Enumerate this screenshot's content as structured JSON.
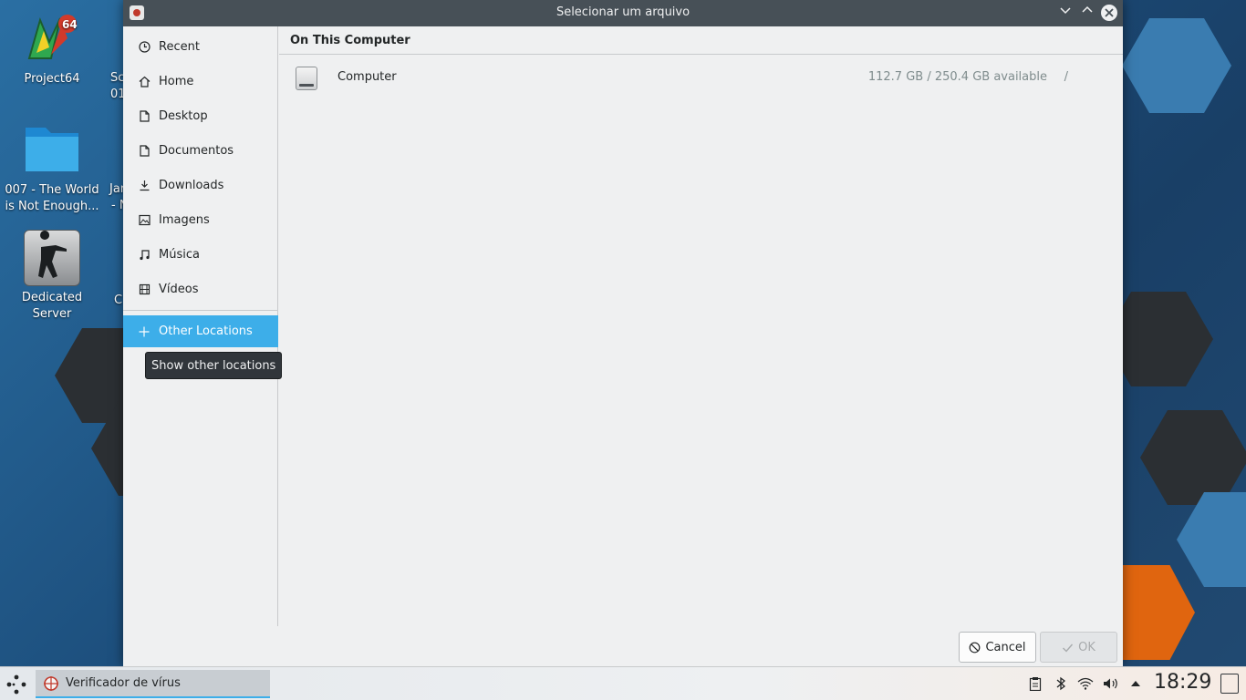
{
  "desktop": {
    "icons": [
      {
        "label": "Project64"
      },
      {
        "label": "007 - The World is Not Enough..."
      },
      {
        "label": "Dedicated Server"
      }
    ],
    "partial_labels": [
      "Sc",
      "01",
      "Jar",
      "- N",
      "C"
    ]
  },
  "dialog": {
    "title": "Selecionar um arquivo",
    "sidebar": {
      "items": [
        {
          "label": "Recent",
          "icon": "clock-icon"
        },
        {
          "label": "Home",
          "icon": "home-icon"
        },
        {
          "label": "Desktop",
          "icon": "desktop-icon"
        },
        {
          "label": "Documentos",
          "icon": "documents-icon"
        },
        {
          "label": "Downloads",
          "icon": "downloads-icon"
        },
        {
          "label": "Imagens",
          "icon": "pictures-icon"
        },
        {
          "label": "Música",
          "icon": "music-icon"
        },
        {
          "label": "Vídeos",
          "icon": "videos-icon"
        }
      ],
      "other_locations": {
        "label": "Other Locations",
        "icon": "plus-icon"
      },
      "tooltip": "Show other locations"
    },
    "main": {
      "section_header": "On This Computer",
      "locations": [
        {
          "name": "Computer",
          "space": "112.7 GB / 250.4 GB available",
          "mount": "/"
        }
      ]
    },
    "buttons": {
      "cancel": "Cancel",
      "ok": "OK"
    }
  },
  "taskbar": {
    "task_label": "Verificador de vírus",
    "clock": "18:29"
  },
  "colors": {
    "accent": "#3daee9",
    "titlebar": "#475057",
    "window_bg": "#eff0f1",
    "wallpaper_orange": "#e0650f"
  }
}
